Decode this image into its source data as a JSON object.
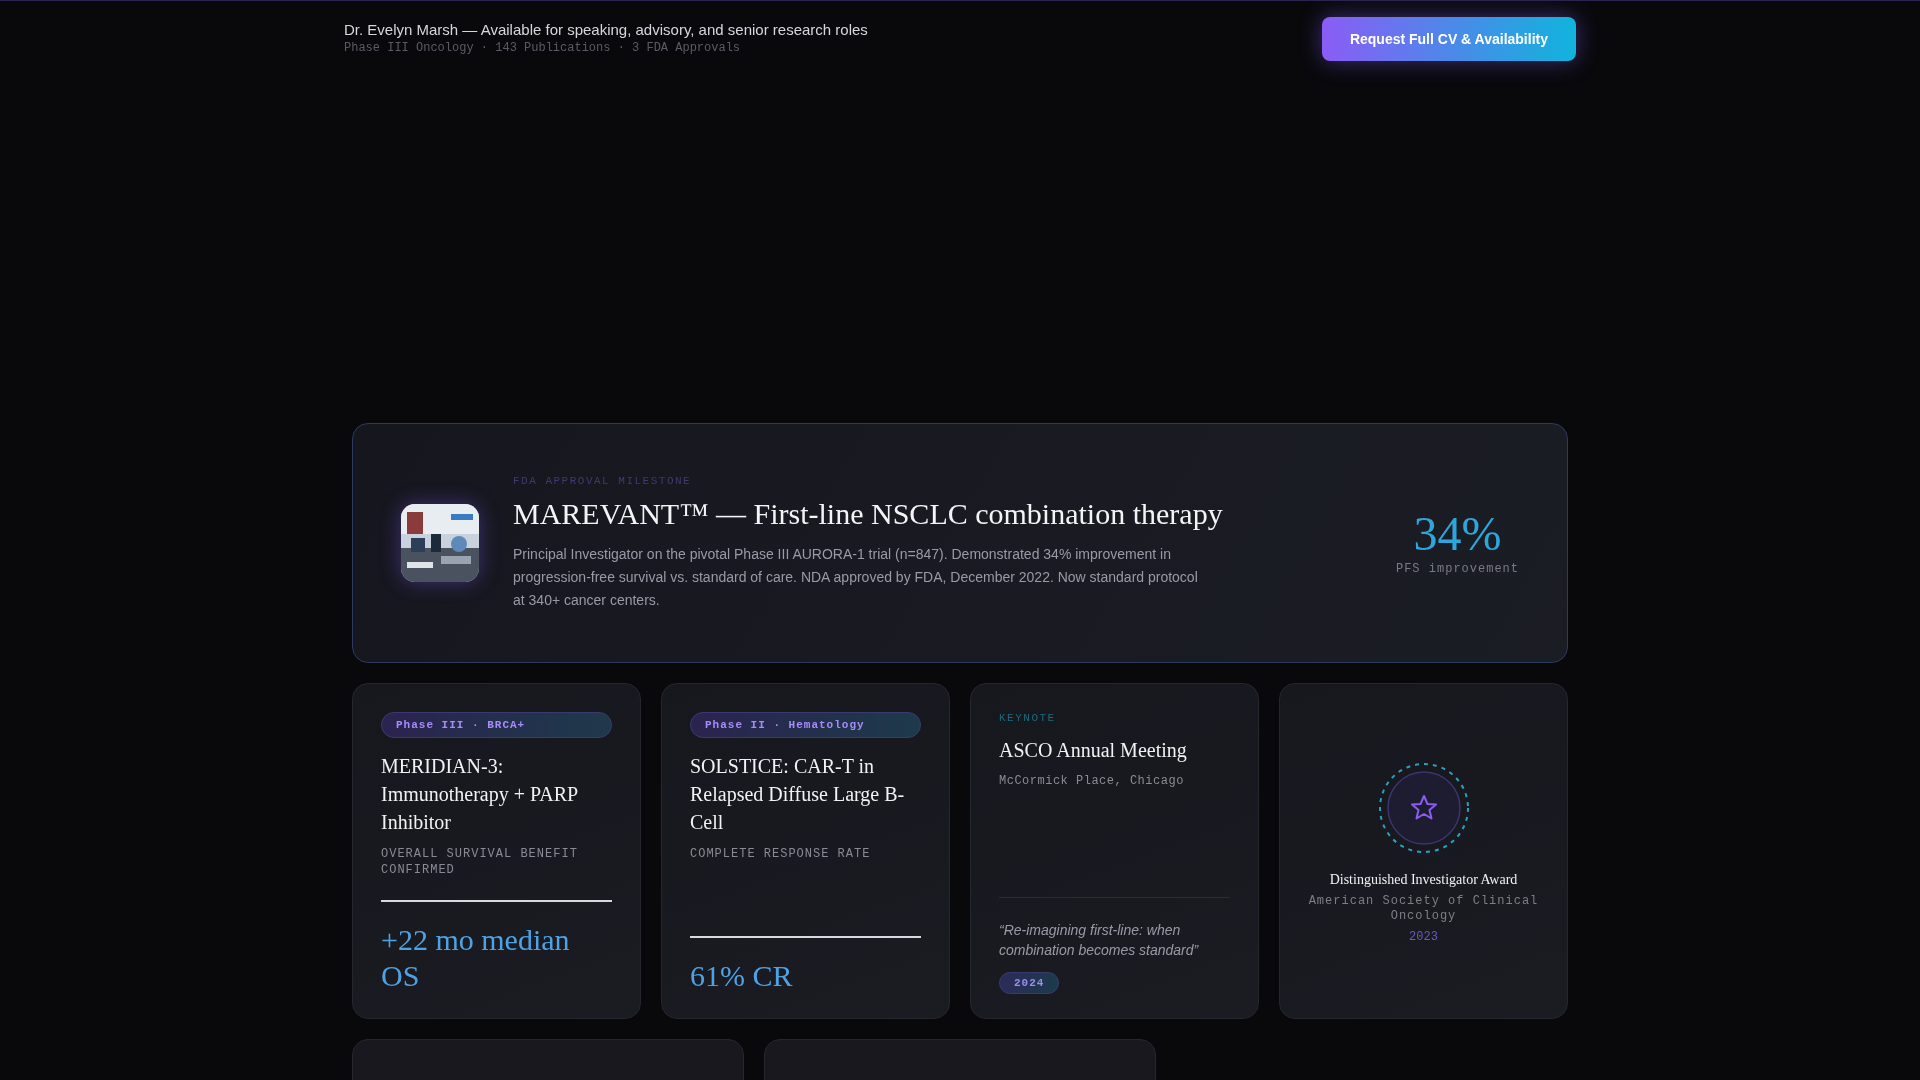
{
  "header": {
    "headline": "Dr. Evelyn Marsh — Available for speaking, advisory, and senior research roles",
    "meta": "Phase III Oncology · 143 Publications · 3 FDA Approvals",
    "cta": "Request Full CV & Availability"
  },
  "feature": {
    "eyebrow": "FDA APPROVAL MILESTONE",
    "title": "MAREVANT™ — First-line NSCLC combination therapy",
    "description": "Principal Investigator on the pivotal Phase III AURORA-1 trial (n=847). Demonstrated 34% improvement in progression-free survival vs. standard of care. NDA approved by FDA, December 2022. Now standard protocol at 340+ cancer centers.",
    "stat": "34%",
    "stat_label": "PFS improvement"
  },
  "cards": [
    {
      "kind": "trial",
      "tag": "Phase III · BRCA+",
      "title": "MERIDIAN-3: Immunotherapy + PARP Inhibitor",
      "subtitle": "OVERALL SURVIVAL BENEFIT CONFIRMED",
      "stat": "+22 mo median OS"
    },
    {
      "kind": "trial",
      "tag": "Phase II · Hematology",
      "title": "SOLSTICE: CAR-T in Relapsed Diffuse Large B-Cell",
      "subtitle": "COMPLETE RESPONSE RATE",
      "stat": "61% CR"
    },
    {
      "kind": "keynote",
      "eyebrow": "KEYNOTE",
      "title": "ASCO Annual Meeting",
      "location": "McCormick Place, Chicago",
      "quote": "“Re-imagining first-line: when combination becomes standard”",
      "year": "2024"
    },
    {
      "kind": "award",
      "title": "Distinguished Investigator Award",
      "org": "American Society of Clinical Oncology",
      "year": "2023"
    }
  ],
  "lower_cards": [
    {
      "kind": "publication"
    },
    {
      "kind": "publication"
    }
  ]
}
